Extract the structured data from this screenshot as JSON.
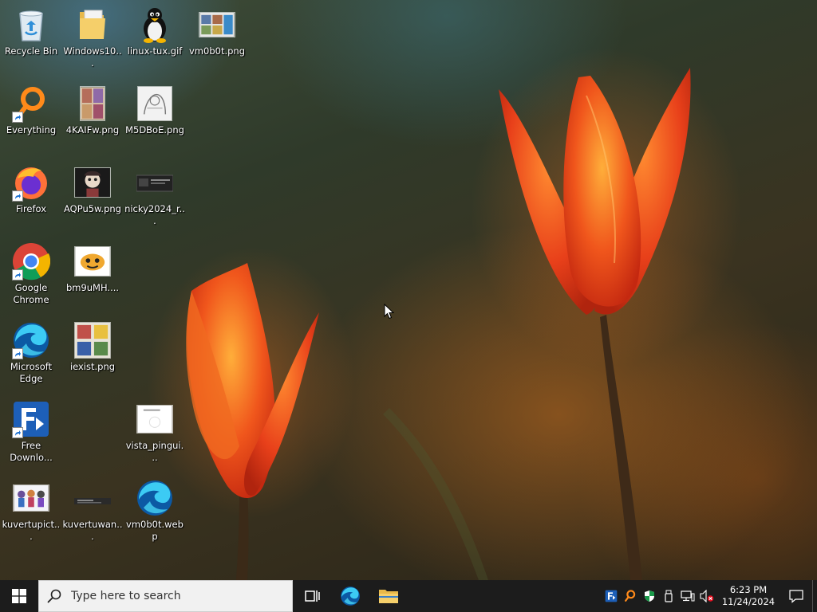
{
  "desktop": {
    "icons": [
      {
        "label": "Recycle Bin"
      },
      {
        "label": "Windows10..."
      },
      {
        "label": "linux-tux.gif"
      },
      {
        "label": "vm0b0t.png"
      },
      {
        "label": "Everything"
      },
      {
        "label": "4KAIFw.png"
      },
      {
        "label": "M5DBoE.png"
      },
      {
        "label": "Firefox"
      },
      {
        "label": "AQPu5w.png"
      },
      {
        "label": "nicky2024_r..."
      },
      {
        "label": "Google Chrome"
      },
      {
        "label": "bm9uMH...."
      },
      {
        "label": "Microsoft Edge"
      },
      {
        "label": "iexist.png"
      },
      {
        "label": "Free Downlo..."
      },
      {
        "label": "vista_pingui..."
      },
      {
        "label": "kuvertupict..."
      },
      {
        "label": "kuvertuwan..."
      },
      {
        "label": "vm0b0t.webp"
      }
    ]
  },
  "taskbar": {
    "search": {
      "placeholder": "Type here to search"
    },
    "clock": {
      "time": "6:23 PM",
      "date": "11/24/2024"
    }
  },
  "colors": {
    "taskbar": "#1c1c1c",
    "search_bg": "#f1f1f1",
    "start_logo": "#ffffff",
    "tulip": "#e8461c"
  }
}
